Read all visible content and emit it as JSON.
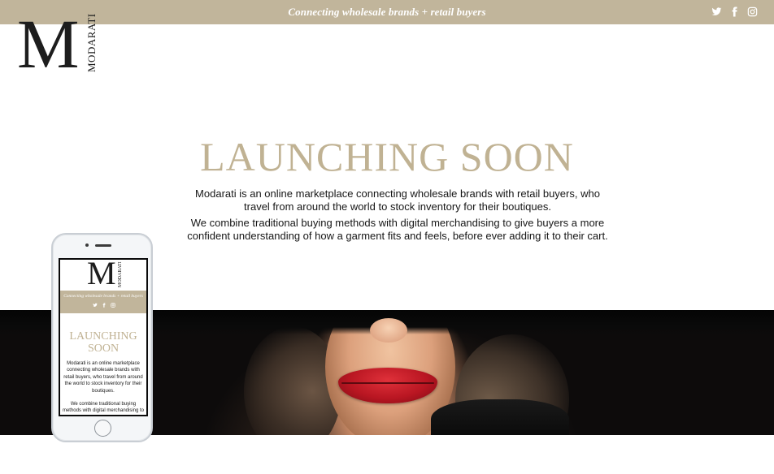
{
  "header": {
    "tagline": "Connecting wholesale brands + retail buyers",
    "social_icons": [
      "twitter-icon",
      "facebook-icon",
      "instagram-icon"
    ],
    "bar_color": "#c1b59b"
  },
  "logo": {
    "letter": "M",
    "word": "MODARATI"
  },
  "hero": {
    "headline": "LAUNCHING SOON",
    "paragraph1": "Modarati is an online marketplace connecting wholesale brands with retail buyers, who travel from around the world to stock inventory for their boutiques.",
    "paragraph2": "We combine traditional buying methods with digital merchandising to give buyers a more confident understanding of how a garment fits and feels, before ever adding it to their cart.",
    "headline_color": "#c0b293"
  },
  "mobile": {
    "logo_letter": "M",
    "logo_word": "MODARATI",
    "tagline": "Connecting wholesale brands + retail buyers",
    "headline_line1": "LAUNCHING",
    "headline_line2": "SOON",
    "paragraph1": "Modarati is an online marketplace connecting wholesale brands with retail buyers, who travel from around the world to stock inventory for their boutiques.",
    "paragraph2": "We combine traditional buying methods with digital merchandising to give buyers"
  }
}
